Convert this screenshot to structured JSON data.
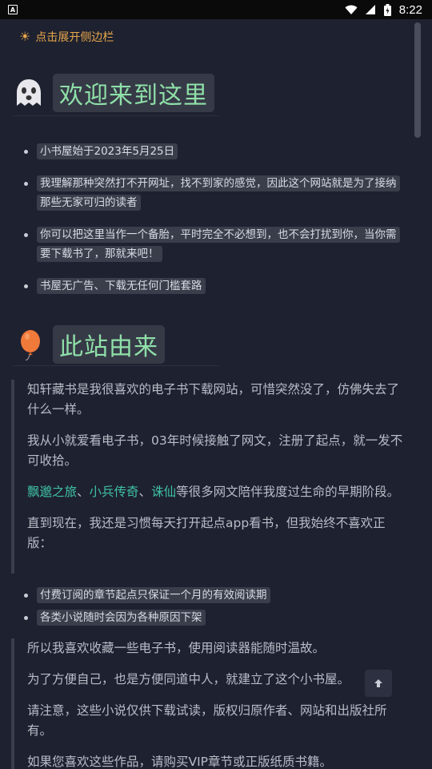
{
  "status_bar": {
    "time": "8:22",
    "icons": [
      "app-notification-icon",
      "wifi-icon",
      "signal-icon",
      "battery-icon"
    ]
  },
  "sidebar_toggle": {
    "icon": "sun-icon",
    "label": "点击展开侧边栏"
  },
  "section_welcome": {
    "emoji": "ghost-icon",
    "title": "欢迎来到这里",
    "items": [
      "小书屋始于2023年5月25日",
      "我理解那种突然打不开网址，找不到家的感觉，因此这个网站就是为了接纳那些无家可归的读者",
      "你可以把这里当作一个备胎，平时完全不必想到，也不会打扰到你，当你需要下载书了，那就来吧！",
      "书屋无广告、下载无任何门槛套路"
    ]
  },
  "section_origin": {
    "emoji": "balloon-icon",
    "title": "此站由来",
    "quote1": {
      "p1": "知轩藏书是我很喜欢的电子书下载网站，可惜突然没了，仿佛失去了什么一样。",
      "p2": "我从小就爱看电子书，03年时候接触了网文，注册了起点，就一发不可收拾。",
      "link1": "飘邈之旅",
      "sep1": "、",
      "link2": "小兵传奇",
      "sep2": "、",
      "link3": "诛仙",
      "p3_rest": "等很多网文陪伴我度过生命的早期阶段。",
      "p4": "直到现在，我还是习惯每天打开起点app看书，但我始终不喜欢正版："
    },
    "items": [
      "付费订阅的章节起点只保证一个月的有效阅读期",
      "各类小说随时会因为各种原因下架"
    ],
    "quote2": {
      "p1": "所以我喜欢收藏一些电子书，使用阅读器能随时温故。",
      "p2": "为了方便自己，也是方便同道中人，就建立了这个小书屋。",
      "p3": "请注意，这些小说仅供下载试读，版权归原作者、网站和出版社所有。",
      "p4": "如果您喜欢这些作品，请购买VIP章节或正版纸质书籍。"
    }
  },
  "back_to_top": {
    "icon": "arrow-up-icon"
  },
  "colors": {
    "background": "#1e2130",
    "accent_green": "#8fe0a8",
    "link": "#3fc1a4",
    "toggle": "#e8a84a"
  }
}
